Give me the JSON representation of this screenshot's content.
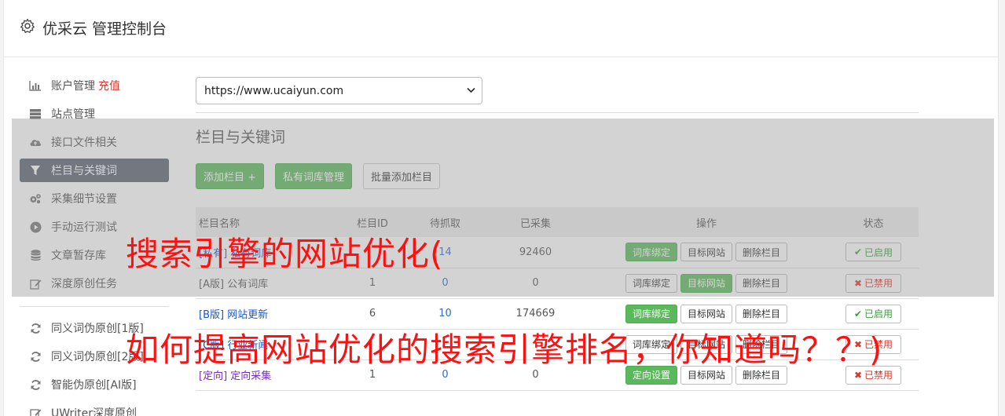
{
  "header": {
    "title": "优采云 管理控制台",
    "icon": "gear-icon"
  },
  "sidebar": {
    "items": [
      {
        "label": "账户管理",
        "extra": "充值",
        "icon": "bar-chart-icon"
      },
      {
        "label": "站点管理",
        "icon": "server-icon"
      },
      {
        "label": "接口文件相关",
        "icon": "cloud-upload-icon"
      },
      {
        "label": "栏目与关键词",
        "icon": "filter-icon",
        "active": true
      },
      {
        "label": "采集细节设置",
        "icon": "cogs-icon"
      },
      {
        "label": "手动运行测试",
        "icon": "play-circle-icon"
      },
      {
        "label": "文章暂存库",
        "icon": "database-icon"
      },
      {
        "label": "深度原创任务",
        "icon": "edit-icon"
      }
    ],
    "items2": [
      {
        "label": "同义词伪原创[1版]",
        "icon": "refresh-icon"
      },
      {
        "label": "同义词伪原创[2版]",
        "icon": "refresh-icon"
      },
      {
        "label": "智能伪原创[AI版]",
        "icon": "refresh-icon"
      },
      {
        "label": "UWriter深度原创",
        "icon": "edit-icon"
      }
    ]
  },
  "main": {
    "site_select": "https://www.ucaiyun.com",
    "section_title": "栏目与关键词",
    "buttons": {
      "add": "添加栏目 +",
      "private_lib": "私有词库管理",
      "batch_add": "批量添加栏目"
    },
    "table": {
      "headers": {
        "name": "栏目名称",
        "id": "栏目ID",
        "pending": "待抓取",
        "collected": "已采集",
        "ops": "操作",
        "status": "状态"
      },
      "rows": [
        {
          "tag": "[私有]",
          "name": "私有词库",
          "id": "",
          "pending": "14",
          "collected": "92460",
          "op1": "词库绑定",
          "op2": "目标网站",
          "op3": "删除栏目",
          "status": "已启用",
          "enabled": true
        },
        {
          "tag": "[A版]",
          "name": "公有词库",
          "id": "1",
          "pending": "0",
          "collected": "0",
          "op1": "词库绑定",
          "op2": "目标网站",
          "op3": "删除栏目",
          "status": "已禁用",
          "enabled": false
        },
        {
          "tag": "[B版]",
          "name": "网站更新",
          "id": "6",
          "pending": "10",
          "collected": "174669",
          "op1": "词库绑定",
          "op2": "目标网站",
          "op3": "删除栏目",
          "status": "已启用",
          "enabled": true
        },
        {
          "tag": "[C版]",
          "name": "行业新闻",
          "id": "",
          "pending": "",
          "collected": "",
          "op1": "词库绑定",
          "op2": "目标网站",
          "op3": "删除栏目",
          "status": "已禁用",
          "enabled": false
        },
        {
          "tag": "[定向]",
          "name": "定向采集",
          "id": "1",
          "pending": "0",
          "collected": "0",
          "op1": "定向设置",
          "op2": "目标网站",
          "op3": "删除栏目",
          "status": "已禁用",
          "enabled": false
        }
      ]
    }
  },
  "watermark": {
    "line1": "搜索引擎的网站优化(",
    "line2": "如何提高网站优化的搜索引擎排名，你知道吗？？)"
  },
  "colors": {
    "green": "#5cb85c",
    "active_nav": "#5b6370",
    "red_text": "#ff1010"
  }
}
